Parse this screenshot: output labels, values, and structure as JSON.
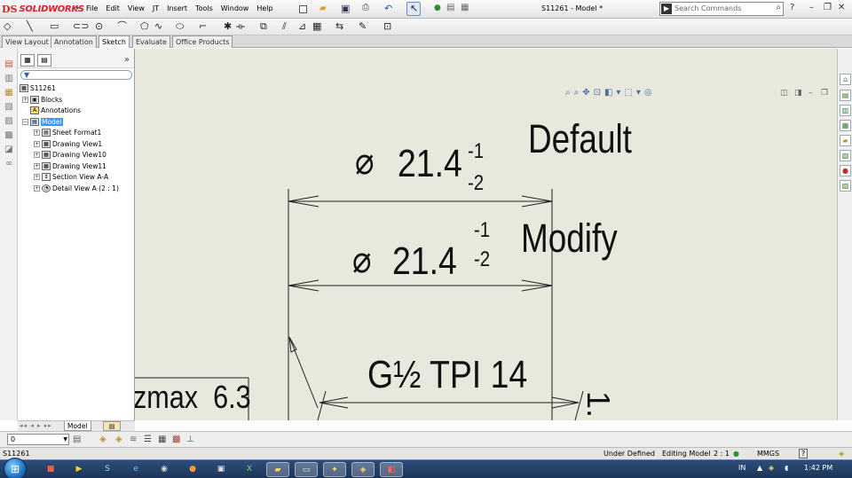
{
  "app": {
    "logo_symbol": "DS",
    "brand": "SOLIDWORKS",
    "document_title": "S11261 - Model *"
  },
  "menu": [
    "File",
    "Edit",
    "View",
    "JT",
    "Insert",
    "Tools",
    "Window",
    "Help"
  ],
  "search": {
    "placeholder": "Search Commands"
  },
  "command_tabs": [
    {
      "label": "View Layout",
      "active": false
    },
    {
      "label": "Annotation",
      "active": false
    },
    {
      "label": "Sketch",
      "active": true
    },
    {
      "label": "Evaluate",
      "active": false
    },
    {
      "label": "Office Products",
      "active": false
    }
  ],
  "feature_tree": {
    "root": "S11261",
    "items": [
      {
        "label": "Blocks",
        "icon": "blocks-icon"
      },
      {
        "label": "Annotations",
        "icon": "annotations-icon"
      },
      {
        "label": "Model",
        "icon": "sheet-icon",
        "selected": true
      },
      {
        "label": "Sheet Format1",
        "icon": "sheet-format-icon"
      },
      {
        "label": "Drawing View1",
        "icon": "drawing-view-icon"
      },
      {
        "label": "Drawing View10",
        "icon": "drawing-view-icon"
      },
      {
        "label": "Drawing View11",
        "icon": "drawing-view-icon"
      },
      {
        "label": "Section View A-A",
        "icon": "section-view-icon"
      },
      {
        "label": "Detail View A (2 : 1)",
        "icon": "detail-view-icon"
      }
    ],
    "sheet_tab": "Model"
  },
  "drawing": {
    "dim1": {
      "diameter_symbol": "⌀",
      "value": "21.4",
      "upper_tol": "-1",
      "lower_tol": "-2",
      "note": "Default"
    },
    "dim2": {
      "diameter_symbol": "⌀",
      "value": "21.4",
      "upper_tol": "-1",
      "lower_tol": "-2",
      "note": "Modify"
    },
    "thread": "G½ TPI 14",
    "roughness": "zmax  6.3",
    "partial_text": "1."
  },
  "option_bar": {
    "layer_value": "0"
  },
  "status": {
    "doc": "S11261",
    "state": "Under Defined",
    "mode": "Editing Model",
    "scale": "2 : 1",
    "units": "MMGS"
  },
  "taskbar": {
    "lang": "IN",
    "clock": "1:42 PM"
  },
  "colors": {
    "canvas_bg": "#e8e8dc",
    "taskbar": "#1c355a",
    "brand": "#d2232a",
    "selection": "#3399ff"
  }
}
